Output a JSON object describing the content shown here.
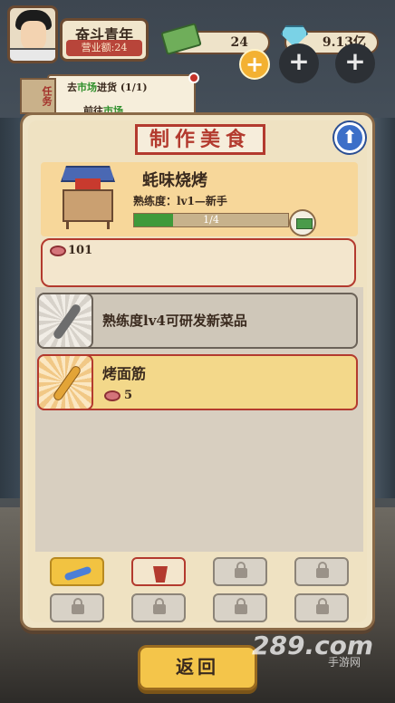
{
  "player": {
    "name": "奋斗青年",
    "revenue": "营业额:24"
  },
  "resources": {
    "cash": "24",
    "gems": "9.13亿"
  },
  "task": {
    "tag": "任务",
    "line1_prefix": "去",
    "line1_link": "市场",
    "line1_suffix": "进货 (1/1)",
    "line2_prefix": "前往",
    "line2_link": "市场"
  },
  "panel": {
    "title": "制作美食",
    "stall": {
      "name": "蚝味烧烤",
      "proficiency": "熟练度：lv1—新手",
      "progress_text": "1/4",
      "progress_value": 0.25
    },
    "ingredient_count": "101",
    "recipes": [
      {
        "label": "熟练度lv4可研发新菜品",
        "locked": true
      },
      {
        "label": "烤面筋",
        "cost": "5",
        "locked": false
      }
    ],
    "tabs": [
      {
        "icon": "skewer-icon",
        "state": "selected"
      },
      {
        "icon": "drink-icon",
        "state": "unlocked"
      },
      {
        "icon": "lock-icon",
        "state": "locked"
      },
      {
        "icon": "lock-icon",
        "state": "locked"
      },
      {
        "icon": "lock-icon",
        "state": "locked"
      },
      {
        "icon": "lock-icon",
        "state": "locked"
      },
      {
        "icon": "lock-icon",
        "state": "locked"
      },
      {
        "icon": "lock-icon",
        "state": "locked"
      }
    ]
  },
  "back_label": "返回",
  "watermark": {
    "logo": "289.com",
    "sub": "手游网"
  },
  "colors": {
    "accent_red": "#b33a2e",
    "gold": "#f4c54a",
    "progress_green": "#3f9a3a",
    "parchment": "#f0e4c6"
  }
}
